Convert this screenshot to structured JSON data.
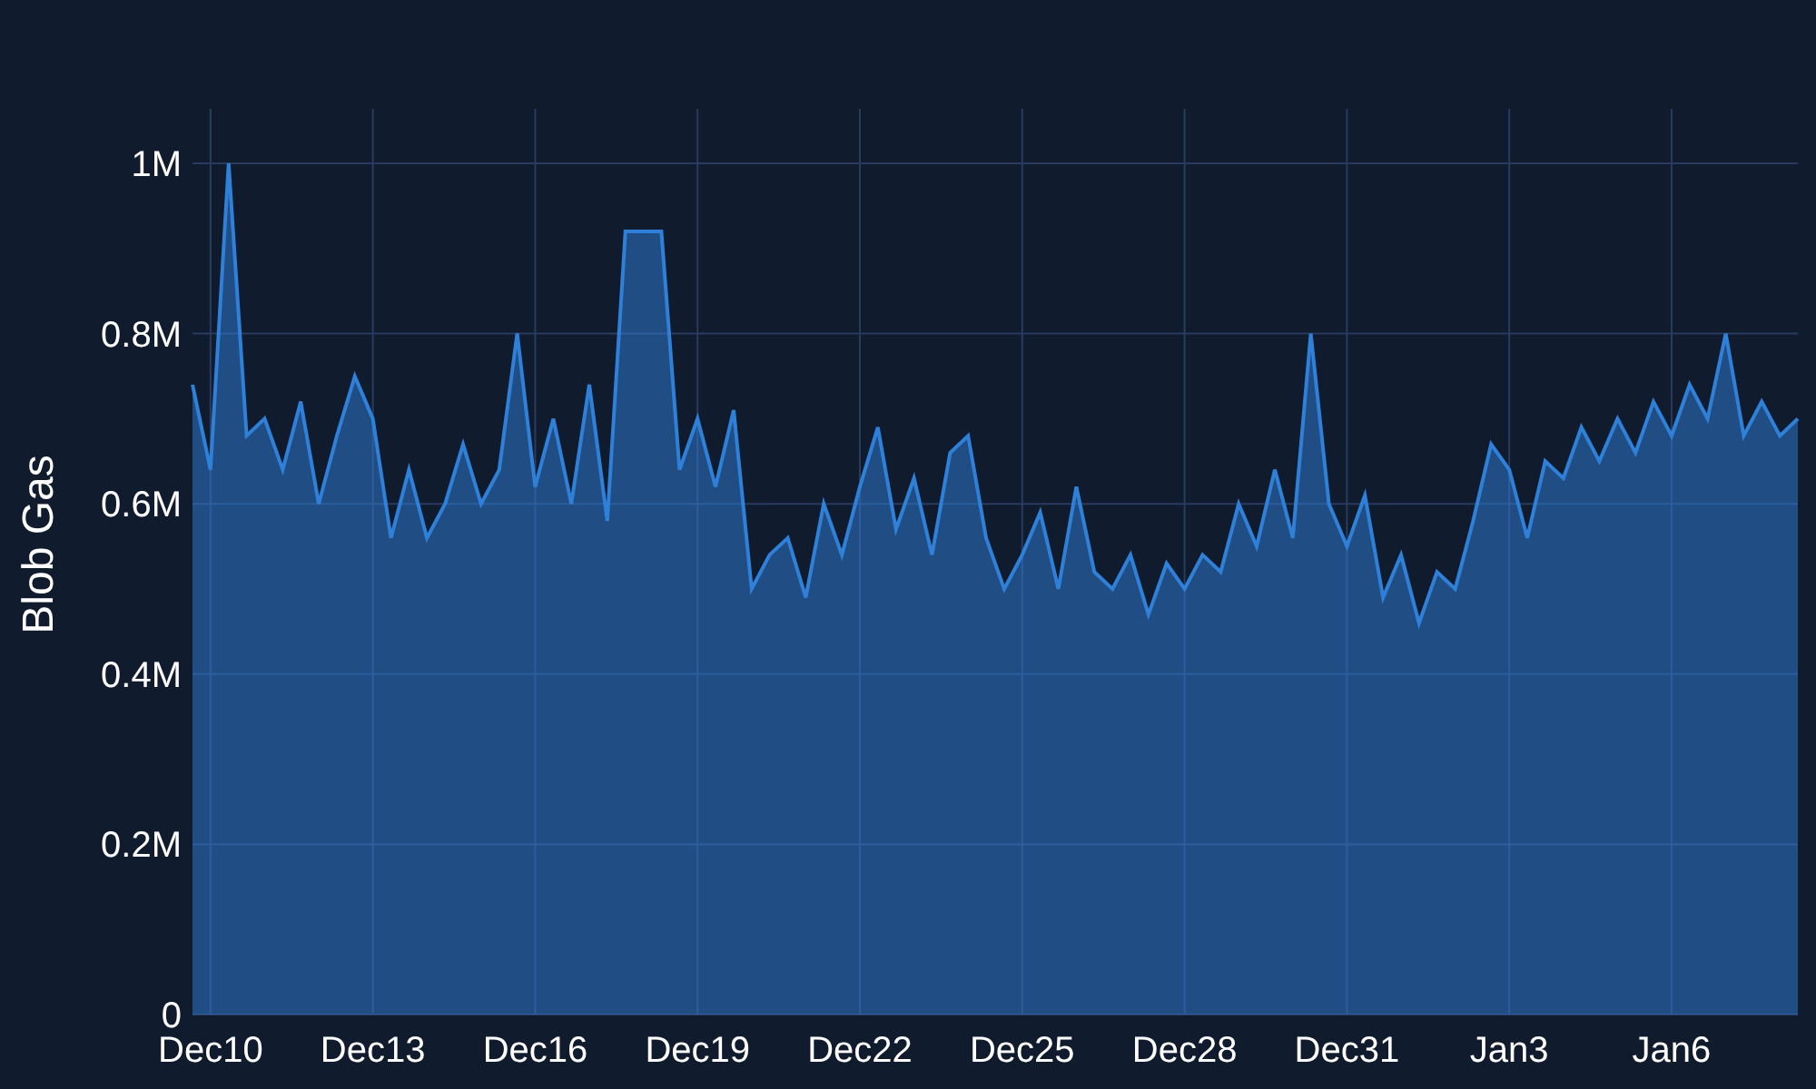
{
  "chart": {
    "chart_data": {
      "type": "area",
      "ylabel": "Blob Gas",
      "grid": true,
      "ylim": [
        0,
        1000000
      ],
      "yticks": [
        {
          "value": 0,
          "label": "0"
        },
        {
          "value": 200000,
          "label": "0.2M"
        },
        {
          "value": 400000,
          "label": "0.4M"
        },
        {
          "value": 600000,
          "label": "0.6M"
        },
        {
          "value": 800000,
          "label": "0.8M"
        },
        {
          "value": 1000000,
          "label": "1M"
        }
      ],
      "categories": [
        null,
        "Dec10",
        null,
        null,
        null,
        null,
        null,
        null,
        null,
        null,
        "Dec13",
        null,
        null,
        null,
        null,
        null,
        null,
        null,
        null,
        "Dec16",
        null,
        null,
        null,
        null,
        null,
        null,
        null,
        null,
        "Dec19",
        null,
        null,
        null,
        null,
        null,
        null,
        null,
        null,
        "Dec22",
        null,
        null,
        null,
        null,
        null,
        null,
        null,
        null,
        "Dec25",
        null,
        null,
        null,
        null,
        null,
        null,
        null,
        null,
        "Dec28",
        null,
        null,
        null,
        null,
        null,
        null,
        null,
        null,
        "Dec31",
        null,
        null,
        null,
        null,
        null,
        null,
        null,
        null,
        "Jan3",
        null,
        null,
        null,
        null,
        null,
        null,
        null,
        null,
        "Jan6",
        null,
        null,
        null,
        null,
        null,
        null,
        null
      ],
      "series": [
        {
          "color": "#2f80d8",
          "values": [
            740000,
            640000,
            1000000,
            680000,
            700000,
            640000,
            720000,
            600000,
            680000,
            750000,
            700000,
            560000,
            640000,
            560000,
            600000,
            670000,
            600000,
            640000,
            800000,
            620000,
            700000,
            600000,
            740000,
            580000,
            920000,
            920000,
            920000,
            640000,
            700000,
            620000,
            710000,
            500000,
            540000,
            560000,
            490000,
            600000,
            540000,
            620000,
            690000,
            570000,
            630000,
            540000,
            660000,
            680000,
            560000,
            500000,
            540000,
            590000,
            500000,
            620000,
            520000,
            500000,
            540000,
            470000,
            530000,
            500000,
            540000,
            520000,
            600000,
            550000,
            640000,
            560000,
            800000,
            600000,
            550000,
            610000,
            490000,
            540000,
            460000,
            520000,
            500000,
            580000,
            670000,
            640000,
            560000,
            650000,
            630000,
            690000,
            650000,
            700000,
            660000,
            720000,
            680000,
            740000,
            700000,
            800000,
            680000,
            720000,
            680000,
            700000
          ]
        }
      ]
    }
  }
}
